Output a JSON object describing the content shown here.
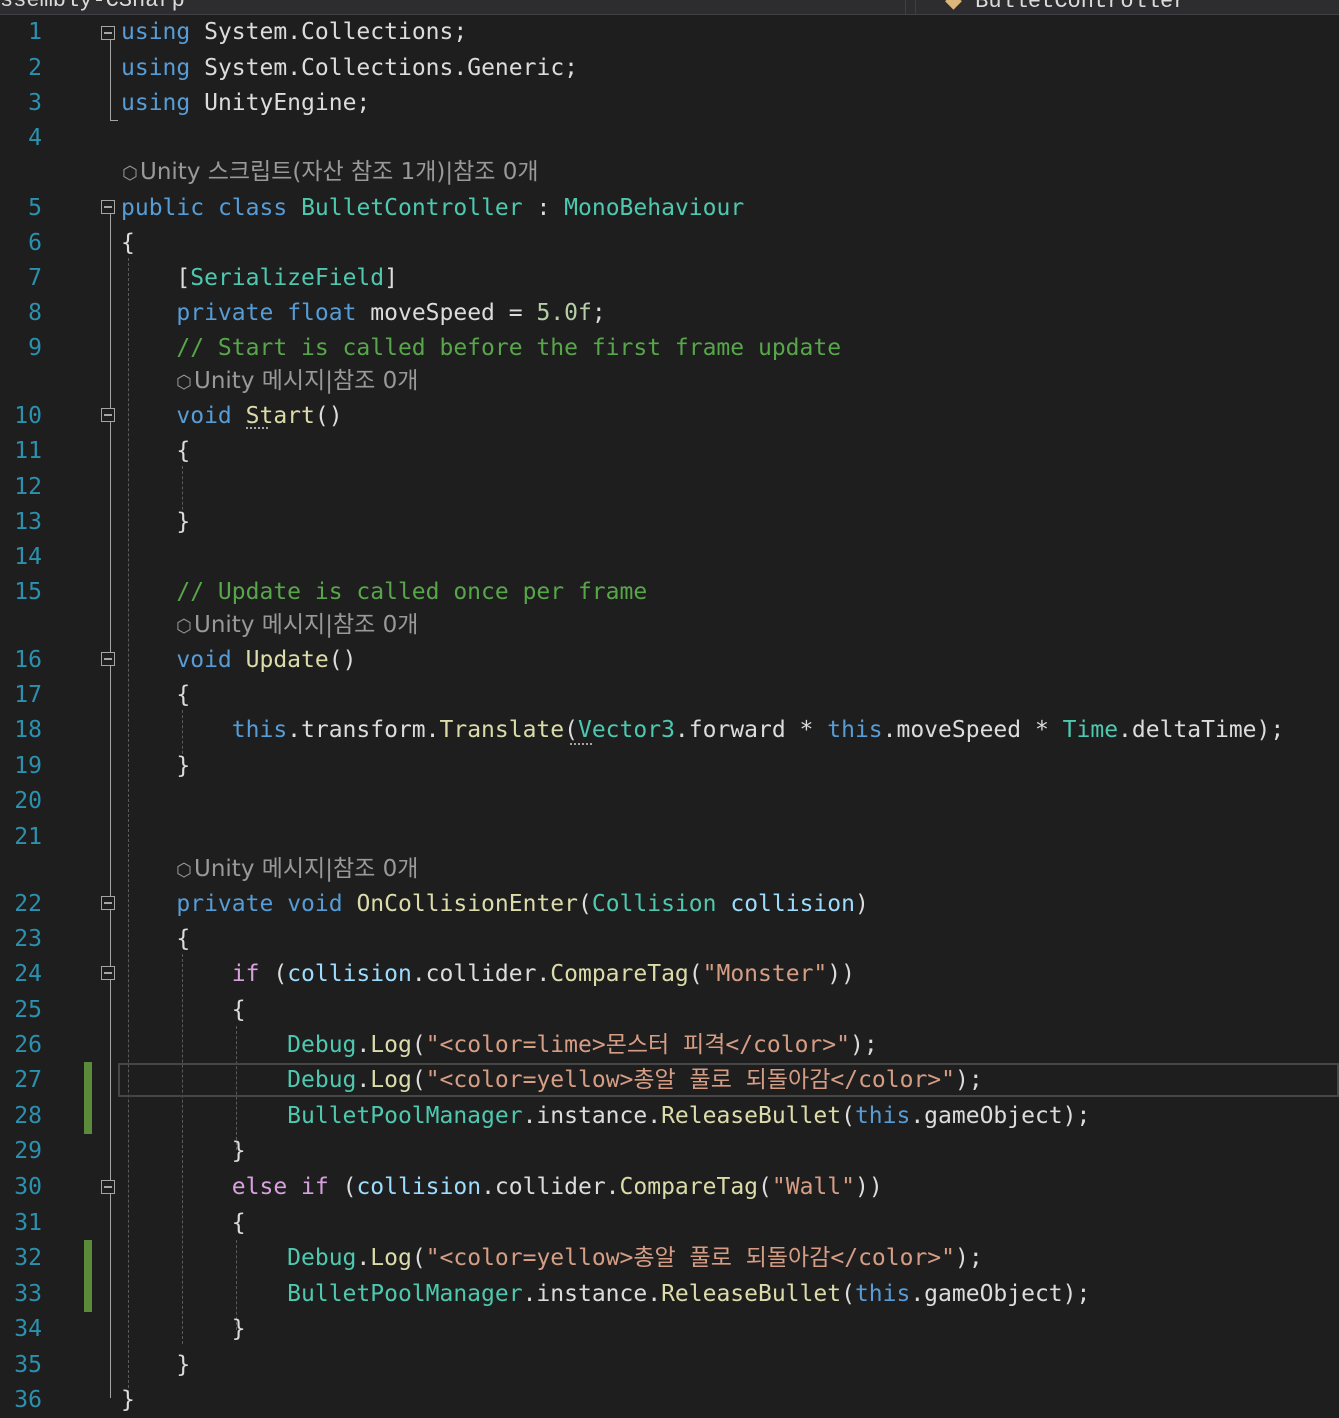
{
  "tabs": {
    "left_tab": "ssembly-CSharp",
    "right_tab": "BulletController"
  },
  "codelens": {
    "class_lens": "Unity 스크립트(자산 참조 1개)|참조 0개",
    "method_lens": "Unity 메시지|참조 0개"
  },
  "colors": {
    "background": "#1e1e1e",
    "keyword": "#569cd6",
    "type": "#4ec9b0",
    "method": "#dcdcaa",
    "string": "#d69d85",
    "comment": "#57a64a",
    "line_number": "#2b91af",
    "change_marker": "#5b8a3a"
  },
  "lines": [
    {
      "n": "1",
      "t": [
        [
          "kw",
          "using"
        ],
        [
          "ns",
          " System"
        ],
        [
          "ident",
          "."
        ],
        [
          "ns",
          "Collections"
        ],
        [
          "ident",
          ";"
        ]
      ]
    },
    {
      "n": "2",
      "t": [
        [
          "kw",
          "using"
        ],
        [
          "ns",
          " System"
        ],
        [
          "ident",
          "."
        ],
        [
          "ns",
          "Collections"
        ],
        [
          "ident",
          "."
        ],
        [
          "ns",
          "Generic"
        ],
        [
          "ident",
          ";"
        ]
      ]
    },
    {
      "n": "3",
      "t": [
        [
          "kw",
          "using"
        ],
        [
          "ns",
          " UnityEngine"
        ],
        [
          "ident",
          ";"
        ]
      ]
    },
    {
      "n": "4",
      "t": []
    },
    {
      "n": "5",
      "t": [
        [
          "kw",
          "public"
        ],
        [
          "ident",
          " "
        ],
        [
          "kw",
          "class"
        ],
        [
          "ident",
          " "
        ],
        [
          "type",
          "BulletController"
        ],
        [
          "ident",
          " : "
        ],
        [
          "type",
          "MonoBehaviour"
        ]
      ]
    },
    {
      "n": "6",
      "t": [
        [
          "ident",
          "{"
        ]
      ]
    },
    {
      "n": "7",
      "t": [
        [
          "ident",
          "    ["
        ],
        [
          "type",
          "SerializeField"
        ],
        [
          "ident",
          "]"
        ]
      ]
    },
    {
      "n": "8",
      "t": [
        [
          "ident",
          "    "
        ],
        [
          "kw",
          "private"
        ],
        [
          "ident",
          " "
        ],
        [
          "kw",
          "float"
        ],
        [
          "ident",
          " moveSpeed = "
        ],
        [
          "num",
          "5.0f"
        ],
        [
          "ident",
          ";"
        ]
      ]
    },
    {
      "n": "9",
      "t": [
        [
          "ident",
          "    "
        ],
        [
          "cmt",
          "// Start is called before the first frame update"
        ]
      ]
    },
    {
      "n": "10",
      "t": [
        [
          "ident",
          "    "
        ],
        [
          "kw",
          "void"
        ],
        [
          "ident",
          " "
        ],
        [
          "method",
          "Start"
        ],
        [
          "ident",
          "()"
        ]
      ]
    },
    {
      "n": "11",
      "t": [
        [
          "ident",
          "    {"
        ]
      ]
    },
    {
      "n": "12",
      "t": []
    },
    {
      "n": "13",
      "t": [
        [
          "ident",
          "    }"
        ]
      ]
    },
    {
      "n": "14",
      "t": []
    },
    {
      "n": "15",
      "t": [
        [
          "ident",
          "    "
        ],
        [
          "cmt",
          "// Update is called once per frame"
        ]
      ]
    },
    {
      "n": "16",
      "t": [
        [
          "ident",
          "    "
        ],
        [
          "kw",
          "void"
        ],
        [
          "ident",
          " "
        ],
        [
          "method",
          "Update"
        ],
        [
          "ident",
          "()"
        ]
      ]
    },
    {
      "n": "17",
      "t": [
        [
          "ident",
          "    {"
        ]
      ]
    },
    {
      "n": "18",
      "t": [
        [
          "ident",
          "        "
        ],
        [
          "kw",
          "this"
        ],
        [
          "ident",
          ".transform."
        ],
        [
          "method",
          "Translate"
        ],
        [
          "ident",
          "("
        ],
        [
          "type",
          "Vector3"
        ],
        [
          "ident",
          ".forward * "
        ],
        [
          "kw",
          "this"
        ],
        [
          "ident",
          ".moveSpeed * "
        ],
        [
          "type",
          "Time"
        ],
        [
          "ident",
          ".deltaTime);"
        ]
      ]
    },
    {
      "n": "19",
      "t": [
        [
          "ident",
          "    }"
        ]
      ]
    },
    {
      "n": "20",
      "t": []
    },
    {
      "n": "21",
      "t": []
    },
    {
      "n": "22",
      "t": [
        [
          "ident",
          "    "
        ],
        [
          "kw",
          "private"
        ],
        [
          "ident",
          " "
        ],
        [
          "kw",
          "void"
        ],
        [
          "ident",
          " "
        ],
        [
          "method",
          "OnCollisionEnter"
        ],
        [
          "ident",
          "("
        ],
        [
          "type",
          "Collision"
        ],
        [
          "ident",
          " "
        ],
        [
          "param",
          "collision"
        ],
        [
          "ident",
          ")"
        ]
      ]
    },
    {
      "n": "23",
      "t": [
        [
          "ident",
          "    {"
        ]
      ]
    },
    {
      "n": "24",
      "t": [
        [
          "ident",
          "        "
        ],
        [
          "kw2",
          "if"
        ],
        [
          "ident",
          " ("
        ],
        [
          "param",
          "collision"
        ],
        [
          "ident",
          ".collider."
        ],
        [
          "method",
          "CompareTag"
        ],
        [
          "ident",
          "("
        ],
        [
          "str",
          "\"Monster\""
        ],
        [
          "ident",
          "))"
        ]
      ]
    },
    {
      "n": "25",
      "t": [
        [
          "ident",
          "        {"
        ]
      ]
    },
    {
      "n": "26",
      "t": [
        [
          "ident",
          "            "
        ],
        [
          "type",
          "Debug"
        ],
        [
          "ident",
          "."
        ],
        [
          "method",
          "Log"
        ],
        [
          "ident",
          "("
        ],
        [
          "str",
          "\"<color=lime>몬스터 피격</color>\""
        ],
        [
          "ident",
          ");"
        ]
      ]
    },
    {
      "n": "27",
      "t": [
        [
          "ident",
          "            "
        ],
        [
          "type",
          "Debug"
        ],
        [
          "ident",
          "."
        ],
        [
          "method",
          "Log"
        ],
        [
          "ident",
          "("
        ],
        [
          "str",
          "\"<color=yellow>총알 풀로 되돌아감</color>\""
        ],
        [
          "ident",
          ");"
        ]
      ]
    },
    {
      "n": "28",
      "t": [
        [
          "ident",
          "            "
        ],
        [
          "type",
          "BulletPoolManager"
        ],
        [
          "ident",
          ".instance."
        ],
        [
          "method",
          "ReleaseBullet"
        ],
        [
          "ident",
          "("
        ],
        [
          "kw",
          "this"
        ],
        [
          "ident",
          ".gameObject);"
        ]
      ]
    },
    {
      "n": "29",
      "t": [
        [
          "ident",
          "        }"
        ]
      ]
    },
    {
      "n": "30",
      "t": [
        [
          "ident",
          "        "
        ],
        [
          "kw2",
          "else"
        ],
        [
          "ident",
          " "
        ],
        [
          "kw2",
          "if"
        ],
        [
          "ident",
          " ("
        ],
        [
          "param",
          "collision"
        ],
        [
          "ident",
          ".collider."
        ],
        [
          "method",
          "CompareTag"
        ],
        [
          "ident",
          "("
        ],
        [
          "str",
          "\"Wall\""
        ],
        [
          "ident",
          "))"
        ]
      ]
    },
    {
      "n": "31",
      "t": [
        [
          "ident",
          "        {"
        ]
      ]
    },
    {
      "n": "32",
      "t": [
        [
          "ident",
          "            "
        ],
        [
          "type",
          "Debug"
        ],
        [
          "ident",
          "."
        ],
        [
          "method",
          "Log"
        ],
        [
          "ident",
          "("
        ],
        [
          "str",
          "\"<color=yellow>총알 풀로 되돌아감</color>\""
        ],
        [
          "ident",
          ");"
        ]
      ]
    },
    {
      "n": "33",
      "t": [
        [
          "ident",
          "            "
        ],
        [
          "type",
          "BulletPoolManager"
        ],
        [
          "ident",
          ".instance."
        ],
        [
          "method",
          "ReleaseBullet"
        ],
        [
          "ident",
          "("
        ],
        [
          "kw",
          "this"
        ],
        [
          "ident",
          ".gameObject);"
        ]
      ]
    },
    {
      "n": "34",
      "t": [
        [
          "ident",
          "        }"
        ]
      ]
    },
    {
      "n": "35",
      "t": [
        [
          "ident",
          "    }"
        ]
      ]
    },
    {
      "n": "36",
      "t": [
        [
          "ident",
          "}"
        ]
      ]
    }
  ]
}
